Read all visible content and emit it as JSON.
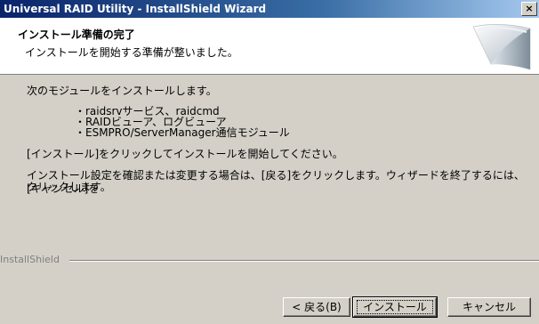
{
  "window": {
    "title": "Universal RAID Utility - InstallShield Wizard",
    "close_glyph": "×"
  },
  "header": {
    "title": "インストール準備の完了",
    "subtitle": "インストールを開始する準備が整いました。"
  },
  "body": {
    "intro": "次のモジュールをインストールします。",
    "modules": [
      "・raidsrvサービス、raidcmd",
      "・RAIDビューア、ログビューア",
      "・ESMPRO/ServerManager通信モジュール"
    ],
    "instruction": "[インストール]をクリックしてインストールを開始してください。",
    "note_line1": "インストール設定を確認または変更する場合は、[戻る]をクリックします。ウィザードを終了するには、[キャンセル]を",
    "note_line2": "クリックします。"
  },
  "brand": "InstallShield",
  "buttons": {
    "back": "< 戻る(B)",
    "install": "インストール",
    "cancel": "キャンセル"
  }
}
